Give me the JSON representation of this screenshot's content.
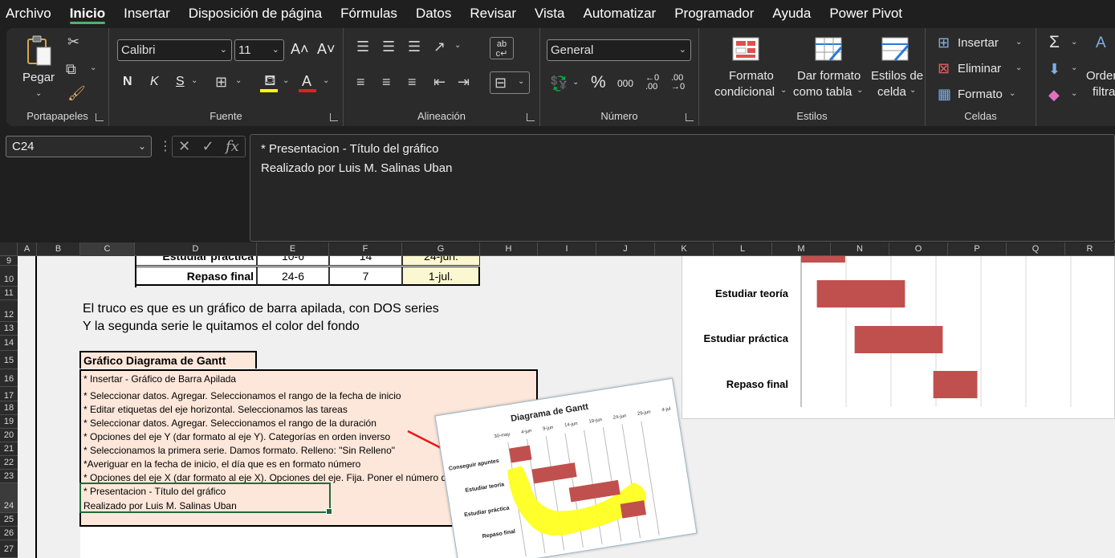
{
  "menu": {
    "tabs": [
      "Archivo",
      "Inicio",
      "Insertar",
      "Disposición de página",
      "Fórmulas",
      "Datos",
      "Revisar",
      "Vista",
      "Automatizar",
      "Programador",
      "Ayuda",
      "Power Pivot"
    ],
    "active": "Inicio"
  },
  "ribbon": {
    "portapapeles": {
      "label": "Portapapeles",
      "paste": "Pegar"
    },
    "fuente": {
      "label": "Fuente",
      "font": "Calibri",
      "size": "11",
      "bold": "N",
      "italic": "K",
      "underline": "S"
    },
    "alineacion": {
      "label": "Alineación"
    },
    "numero": {
      "label": "Número",
      "format": "General",
      "percent": "%",
      "thousands": "000"
    },
    "estilos": {
      "label": "Estilos",
      "cond1": "Formato",
      "cond2": "condicional",
      "table1": "Dar formato",
      "table2": "como tabla",
      "cell1": "Estilos de",
      "cell2": "celda"
    },
    "celdas": {
      "label": "Celdas",
      "insert": "Insertar",
      "delete": "Eliminar",
      "format": "Formato"
    },
    "edicion": {
      "sort1": "Orden",
      "sort2": "filtra",
      "sigma": "Σ"
    }
  },
  "formula_bar": {
    "name_box": "C24",
    "line1": "* Presentacion - Título del gráfico",
    "line2": "Realizado por Luis M. Salinas Uban"
  },
  "columns": [
    "A",
    "B",
    "C",
    "D",
    "E",
    "F",
    "G",
    "H",
    "I",
    "J",
    "K",
    "L",
    "M",
    "N",
    "O",
    "P",
    "Q",
    "R"
  ],
  "rows": [
    "9",
    "10",
    "11",
    "12",
    "13",
    "14",
    "15",
    "16",
    "17",
    "18",
    "19",
    "20",
    "21",
    "22",
    "23",
    "24",
    "25",
    "26",
    "27"
  ],
  "table": {
    "row9": {
      "task": "Estudiar práctica",
      "start": "10-6",
      "dur": "14",
      "end": "24-jun."
    },
    "row10": {
      "task": "Repaso final",
      "start": "24-6",
      "dur": "7",
      "end": "1-jul."
    }
  },
  "explanation": {
    "line1": "El truco es que es un gráfico de barra apilada, con DOS series",
    "line2": "Y la segunda serie le quitamos el color del fondo"
  },
  "notes": {
    "title": "Gráfico Diagrama de Gantt",
    "lines": [
      "* Insertar - Gráfico de Barra Apilada",
      "* Seleccionar datos. Agregar. Seleccionamos el rango de la fecha de inicio",
      "* Editar etiquetas del eje horizontal. Seleccionamos las tareas",
      "* Seleccionar datos. Agregar. Seleccionamos el rango de la duración",
      "* Opciones del eje Y (dar formato al eje Y). Categorías en orden inverso",
      "* Seleccionamos la primera serie. Damos formato. Relleno:  \"Sin Relleno\"",
      "*Averiguar en la fecha de inicio, el día que es en formato número",
      "* Opciones del eje X (dar formato al eje X). Opciones del eje. Fija. Poner el número d"
    ],
    "selected_line1": "* Presentacion - Título del gráfico",
    "selected_line2": "Realizado por Luis M. Salinas Uban"
  },
  "chart_data": {
    "type": "bar",
    "categories": [
      "Estudiar teoría",
      "Estudiar práctica",
      "Repaso final"
    ],
    "series": [
      {
        "values_start_offset": [
          0.05,
          0.17,
          0.42
        ],
        "values_length": [
          0.28,
          0.28,
          0.14
        ]
      }
    ],
    "colors": {
      "bar": "#c0504d",
      "grid": "#d9d9d9"
    }
  },
  "picture": {
    "title": "Diagrama de Gantt",
    "dates": [
      "30-may",
      "4-jun",
      "9-jun",
      "14-jun",
      "19-jun",
      "24-jun",
      "29-jun",
      "4-jul"
    ],
    "tasks": [
      "Conseguir apuntes",
      "Estudiar teoría",
      "Estudiar práctica",
      "Repaso final"
    ]
  }
}
